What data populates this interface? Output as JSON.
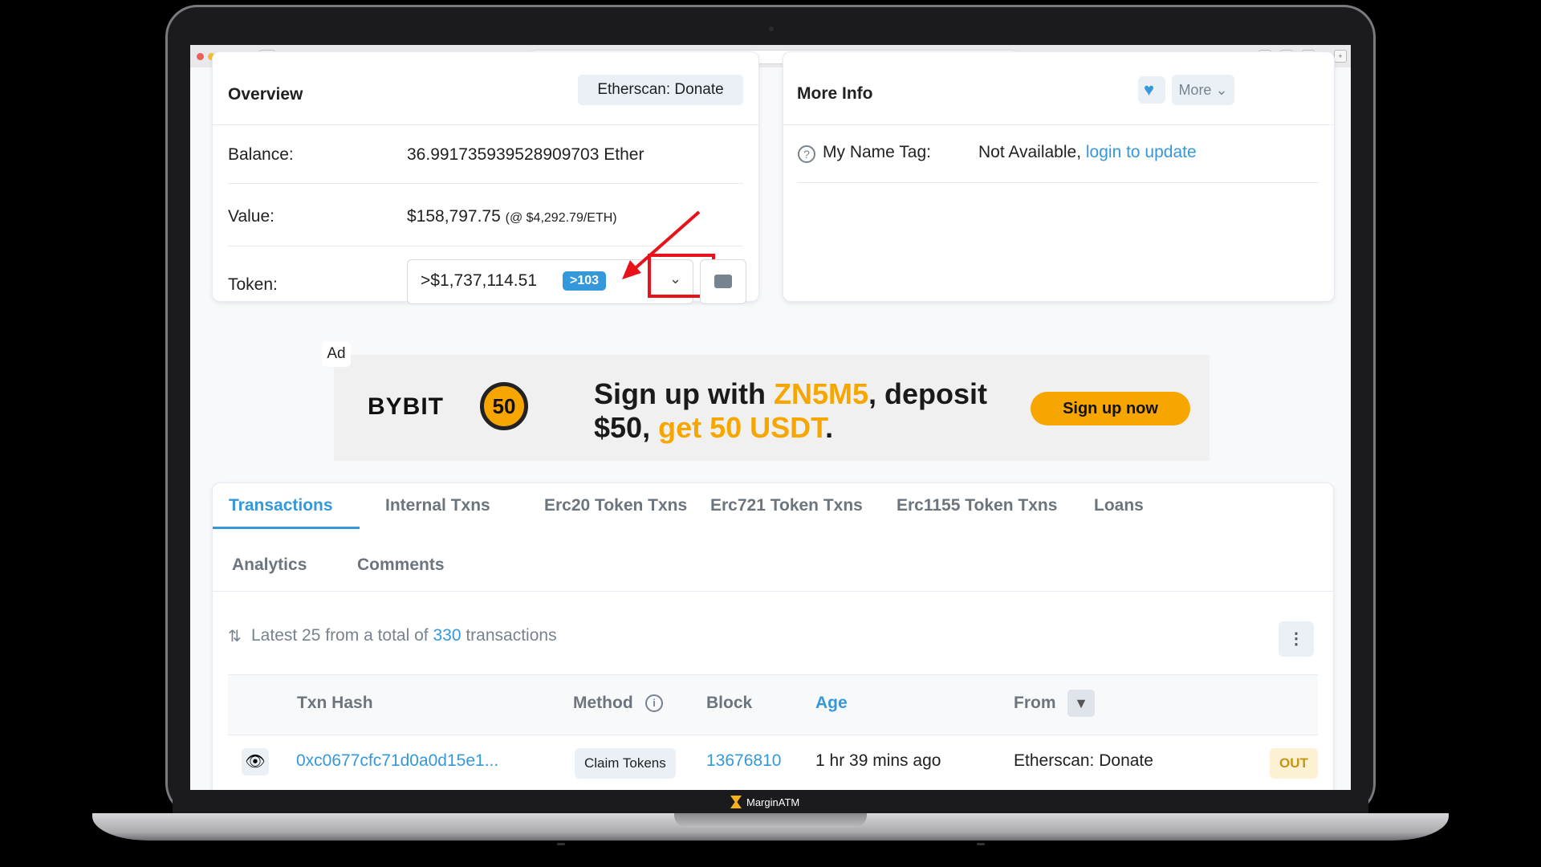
{
  "brand": "MarginATM",
  "overview": {
    "title": "Overview",
    "donate_button": "Etherscan: Donate",
    "balance_label": "Balance:",
    "balance_value": "36.991735939528909703 Ether",
    "value_label": "Value:",
    "value_amount": "$158,797.75",
    "value_rate": "(@ $4,292.79/ETH)",
    "token_label": "Token:",
    "token_value": ">$1,737,114.51",
    "token_badge": ">103"
  },
  "more_info": {
    "title": "More Info",
    "more_button": "More",
    "name_tag_label": "My Name Tag:",
    "name_tag_value": "Not Available,",
    "name_tag_link": "login to update"
  },
  "ad": {
    "label": "Ad",
    "logo": "BYBIT",
    "coin_value": "50",
    "headline_a": "Sign up with ",
    "headline_code": "ZN5M5",
    "headline_b": ", deposit",
    "headline_c": "$50, ",
    "headline_d": "get 50 USDT",
    "headline_e": ".",
    "cta": "Sign up now"
  },
  "tabs": [
    "Transactions",
    "Internal Txns",
    "Erc20 Token Txns",
    "Erc721 Token Txns",
    "Erc1155 Token Txns",
    "Loans",
    "Analytics",
    "Comments"
  ],
  "summary": {
    "prefix": "Latest 25 from a total of ",
    "count": "330",
    "suffix": " transactions"
  },
  "table": {
    "headers": {
      "hash": "Txn Hash",
      "method": "Method",
      "block": "Block",
      "age": "Age",
      "from": "From"
    },
    "rows": [
      {
        "hash": "0xc0677cfc71d0a0d15e1...",
        "method": "Claim Tokens",
        "block": "13676810",
        "age": "1 hr 39 mins ago",
        "from": "Etherscan: Donate",
        "direction": "OUT"
      }
    ]
  },
  "colors": {
    "accent": "#3498db",
    "highlight": "#e8121b",
    "ad_yellow": "#f7a600"
  }
}
